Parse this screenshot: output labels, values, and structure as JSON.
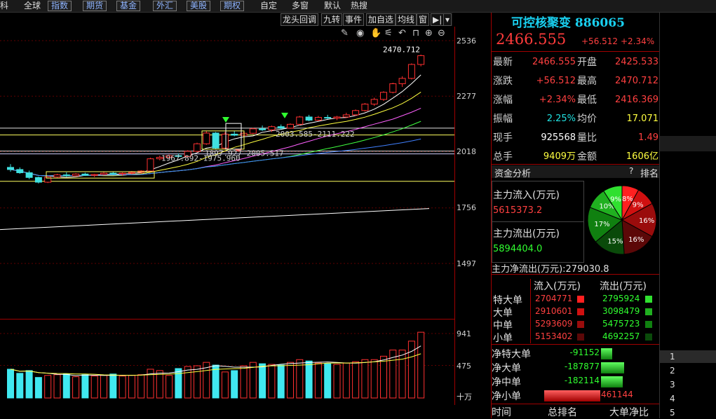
{
  "topbar": {
    "tabs": [
      "科",
      "全球",
      "指数",
      "期货",
      "基金",
      "外汇",
      "美股",
      "期权",
      "自定",
      "多窗",
      "默认",
      "热搜"
    ],
    "boxed": [
      "指数",
      "期货",
      "基金",
      "外汇",
      "美股",
      "期权"
    ]
  },
  "toolbar": {
    "buttons": [
      "龙头回调",
      "九转",
      "事件",
      "加自选",
      "均线",
      "窗"
    ]
  },
  "axis": {
    "price_ticks": [
      "2536",
      "2277",
      "2018",
      "1756",
      "1497"
    ],
    "vol_ticks": [
      "941",
      "475"
    ],
    "vol_unit": "十万"
  },
  "annotations": {
    "high_label": "2470.712",
    "range1": "2003.585-2111.222",
    "range2": "1897.927-2005.517",
    "range3": "1967.892-1975.960"
  },
  "quote": {
    "name": "可控核聚变",
    "code": "886065",
    "price": "2466.555",
    "change": "+56.512",
    "pct": "+2.34%",
    "rows": [
      {
        "l1": "最新",
        "v1": "2466.555",
        "c1": "red",
        "l2": "开盘",
        "v2": "2425.533",
        "c2": "red"
      },
      {
        "l1": "涨跌",
        "v1": "+56.512",
        "c1": "red",
        "l2": "最高",
        "v2": "2470.712",
        "c2": "red"
      },
      {
        "l1": "涨幅",
        "v1": "+2.34%",
        "c1": "red",
        "l2": "最低",
        "v2": "2416.369",
        "c2": "red"
      },
      {
        "l1": "振幅",
        "v1": "2.25%",
        "c1": "cyan",
        "l2": "均价",
        "v2": "17.071",
        "c2": "yel"
      },
      {
        "l1": "现手",
        "v1": "925568",
        "c1": "wht",
        "l2": "量比",
        "v2": "1.49",
        "c2": "red"
      },
      {
        "l1": "总手",
        "v1": "9409万",
        "c1": "yel",
        "l2": "金额",
        "v2": "1606亿",
        "c2": "yel"
      }
    ]
  },
  "fund": {
    "header": "资金分析",
    "help": "?",
    "rank": "排名",
    "inflow_label": "主力流入(万元)",
    "inflow_value": "5615373.2",
    "outflow_label": "主力流出(万元)",
    "outflow_value": "5894404.0",
    "net_label": "主力净流出(万元):279030.8",
    "pie": [
      {
        "label": "8%",
        "value": 8,
        "color": "#ff2020"
      },
      {
        "label": "9%",
        "value": 9,
        "color": "#d01010"
      },
      {
        "label": "16%",
        "value": 16,
        "color": "#9a0c0c"
      },
      {
        "label": "16%",
        "value": 16,
        "color": "#5c0808"
      },
      {
        "label": "15%",
        "value": 15,
        "color": "#0a4a0a"
      },
      {
        "label": "17%",
        "value": 17,
        "color": "#108010"
      },
      {
        "label": "10%",
        "value": 10,
        "color": "#20b020"
      },
      {
        "label": "9%",
        "value": 9,
        "color": "#30e030"
      }
    ],
    "col_in": "流入(万元)",
    "col_out": "流出(万元)",
    "table": [
      {
        "name": "特大单",
        "in": "2704771",
        "out": "2795924",
        "cin": "#ff2020",
        "cout": "#30e030"
      },
      {
        "name": "大单",
        "in": "2910601",
        "out": "3098479",
        "cin": "#d01010",
        "cout": "#20b020"
      },
      {
        "name": "中单",
        "in": "5293609",
        "out": "5475723",
        "cin": "#9a0c0c",
        "cout": "#108010"
      },
      {
        "name": "小单",
        "in": "5153402",
        "out": "4692257",
        "cin": "#5c0808",
        "cout": "#0a4a0a"
      }
    ],
    "net": [
      {
        "name": "净特大单",
        "value": "-91152",
        "dir": "neg",
        "frac": 0.2
      },
      {
        "name": "净大单",
        "value": "-187877",
        "dir": "neg",
        "frac": 0.41
      },
      {
        "name": "净中单",
        "value": "-182114",
        "dir": "neg",
        "frac": 0.39
      },
      {
        "name": "净小单",
        "value": "461144",
        "dir": "pos",
        "frac": 1.0
      }
    ],
    "footer": [
      "时间",
      "总排名",
      "大单净比"
    ]
  },
  "side": {
    "items": [
      "1",
      "2",
      "3",
      "4",
      "5"
    ]
  },
  "candles": [
    [
      1945,
      1960,
      1925,
      1935
    ],
    [
      1935,
      1945,
      1915,
      1920
    ],
    [
      1920,
      1930,
      1890,
      1898
    ],
    [
      1898,
      1902,
      1870,
      1876
    ],
    [
      1876,
      1905,
      1872,
      1900
    ],
    [
      1900,
      1915,
      1895,
      1910
    ],
    [
      1910,
      1922,
      1900,
      1906
    ],
    [
      1906,
      1918,
      1902,
      1914
    ],
    [
      1914,
      1920,
      1905,
      1908
    ],
    [
      1908,
      1915,
      1900,
      1912
    ],
    [
      1912,
      1925,
      1908,
      1918
    ],
    [
      1918,
      1926,
      1910,
      1914
    ],
    [
      1914,
      1922,
      1906,
      1918
    ],
    [
      1918,
      1928,
      1912,
      1922
    ],
    [
      1922,
      1932,
      1916,
      1928
    ],
    [
      1928,
      1990,
      1925,
      1985
    ],
    [
      1985,
      2000,
      1978,
      1992
    ],
    [
      1992,
      2005,
      1988,
      2000
    ],
    [
      2000,
      2010,
      1990,
      1996
    ],
    [
      1996,
      2025,
      1992,
      2020
    ],
    [
      2020,
      2060,
      2015,
      2055
    ],
    [
      2055,
      2115,
      2050,
      2105
    ],
    [
      2105,
      2110,
      2030,
      2035
    ],
    [
      2035,
      2110,
      2030,
      2100
    ],
    [
      2100,
      2115,
      2090,
      2095
    ],
    [
      2095,
      2110,
      2088,
      2104
    ],
    [
      2104,
      2130,
      2100,
      2125
    ],
    [
      2125,
      2140,
      2115,
      2120
    ],
    [
      2120,
      2140,
      2110,
      2135
    ],
    [
      2135,
      2145,
      2122,
      2128
    ],
    [
      2128,
      2150,
      2125,
      2146
    ],
    [
      2146,
      2185,
      2140,
      2180
    ],
    [
      2180,
      2190,
      2160,
      2165
    ],
    [
      2165,
      2185,
      2160,
      2178
    ],
    [
      2178,
      2190,
      2170,
      2175
    ],
    [
      2175,
      2185,
      2165,
      2180
    ],
    [
      2180,
      2200,
      2175,
      2190
    ],
    [
      2190,
      2215,
      2185,
      2210
    ],
    [
      2210,
      2245,
      2205,
      2240
    ],
    [
      2240,
      2270,
      2232,
      2262
    ],
    [
      2262,
      2300,
      2255,
      2295
    ],
    [
      2295,
      2340,
      2290,
      2335
    ],
    [
      2335,
      2370,
      2320,
      2360
    ],
    [
      2360,
      2430,
      2355,
      2425
    ],
    [
      2425,
      2471,
      2416,
      2466
    ]
  ],
  "volumes": [
    420,
    360,
    400,
    300,
    330,
    340,
    350,
    310,
    340,
    320,
    330,
    350,
    320,
    330,
    340,
    420,
    400,
    330,
    430,
    460,
    470,
    520,
    480,
    380,
    400,
    470,
    520,
    500,
    490,
    480,
    520,
    560,
    540,
    510,
    500,
    490,
    510,
    530,
    560,
    560,
    610,
    700,
    700,
    830,
    960
  ]
}
